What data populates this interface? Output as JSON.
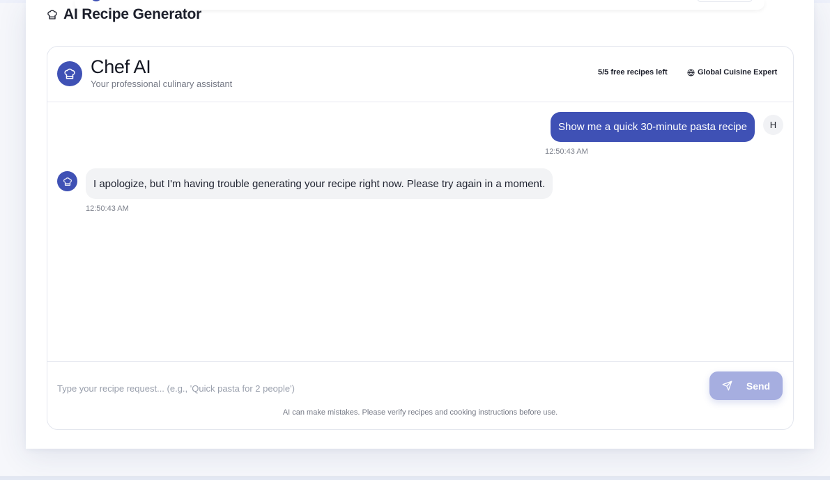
{
  "app": {
    "title": "AI Recipe Generator"
  },
  "chat": {
    "header": {
      "name": "Chef AI",
      "subtitle": "Your professional culinary assistant",
      "free_recipes": "5/5 free recipes left",
      "expertise": "Global Cuisine Expert"
    },
    "messages": [
      {
        "role": "user",
        "avatar": "H",
        "text": "Show me a quick 30-minute pasta recipe",
        "time": "12:50:43 AM"
      },
      {
        "role": "assistant",
        "text": "I apologize, but I'm having trouble generating your recipe right now. Please try again in a moment.",
        "time": "12:50:43 AM"
      }
    ],
    "composer": {
      "placeholder": "Type your recipe request... (e.g., 'Quick pasta for 2 people')",
      "send_label": "Send",
      "disclaimer": "AI can make mistakes. Please verify recipes and cooking instructions before use."
    }
  },
  "colors": {
    "accent": "#3f51b5",
    "send_disabled": "#a6aee0",
    "bot_bubble": "#f2f3f5"
  },
  "icons": {
    "title": "chef-hat-icon",
    "avatar": "chef-hat-icon",
    "expertise": "globe-icon",
    "send": "send-icon"
  }
}
